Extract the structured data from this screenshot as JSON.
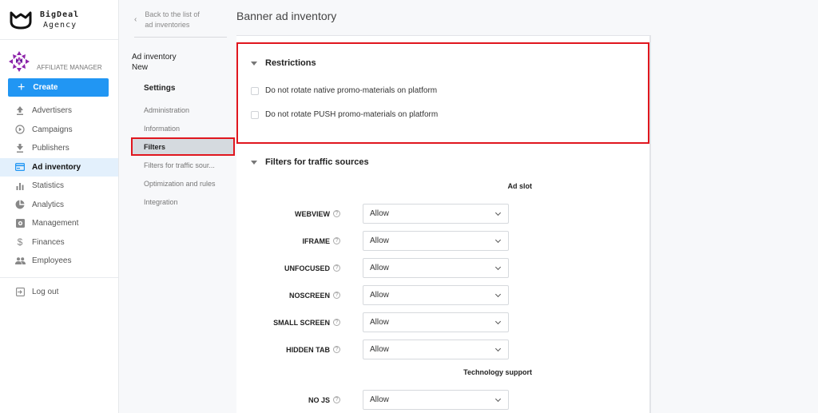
{
  "brand": {
    "line1": "BigDeal",
    "line2": "Agency"
  },
  "role": {
    "label": "AFFILIATE MANAGER"
  },
  "create_button": {
    "label": "Create"
  },
  "sidebar": {
    "items": [
      {
        "label": "Advertisers",
        "icon": "upload-icon",
        "active": false
      },
      {
        "label": "Campaigns",
        "icon": "play-circle-icon",
        "active": false
      },
      {
        "label": "Publishers",
        "icon": "download-icon",
        "active": false
      },
      {
        "label": "Ad inventory",
        "icon": "card-icon",
        "active": true
      },
      {
        "label": "Statistics",
        "icon": "bar-chart-icon",
        "active": false
      },
      {
        "label": "Analytics",
        "icon": "pie-chart-icon",
        "active": false
      },
      {
        "label": "Management",
        "icon": "settings-box-icon",
        "active": false
      },
      {
        "label": "Finances",
        "icon": "dollar-icon",
        "active": false
      },
      {
        "label": "Employees",
        "icon": "people-icon",
        "active": false
      }
    ],
    "logout": {
      "label": "Log out",
      "icon": "logout-icon"
    }
  },
  "subnav": {
    "back_line1": "Back to the list of",
    "back_line2": "ad inventories",
    "title": "Ad inventory",
    "subtitle": "New",
    "section": "Settings",
    "items": [
      {
        "label": "Administration",
        "active": false
      },
      {
        "label": "Information",
        "active": false
      },
      {
        "label": "Filters",
        "active": true
      },
      {
        "label": "Filters for traffic sour...",
        "active": false
      },
      {
        "label": "Optimization and rules",
        "active": false
      },
      {
        "label": "Integration",
        "active": false
      }
    ]
  },
  "main": {
    "page_title": "Banner ad inventory",
    "restrictions": {
      "title": "Restrictions",
      "options": [
        {
          "label": "Do not rotate native promo-materials on platform",
          "checked": false
        },
        {
          "label": "Do not rotate PUSH promo-materials on platform",
          "checked": false
        }
      ]
    },
    "traffic_filters": {
      "title": "Filters for traffic sources",
      "groups": [
        {
          "label": "Ad slot",
          "fields": [
            {
              "label": "WEBVIEW",
              "value": "Allow"
            },
            {
              "label": "IFRAME",
              "value": "Allow"
            },
            {
              "label": "UNFOCUSED",
              "value": "Allow"
            },
            {
              "label": "NOSCREEN",
              "value": "Allow"
            },
            {
              "label": "SMALL SCREEN",
              "value": "Allow"
            },
            {
              "label": "HIDDEN TAB",
              "value": "Allow"
            }
          ]
        },
        {
          "label": "Technology support",
          "fields": [
            {
              "label": "NO JS",
              "value": "Allow"
            }
          ]
        }
      ]
    }
  },
  "colors": {
    "accent": "#2196f3",
    "highlight": "#e0161e",
    "active_bg": "#e3f0fc"
  }
}
